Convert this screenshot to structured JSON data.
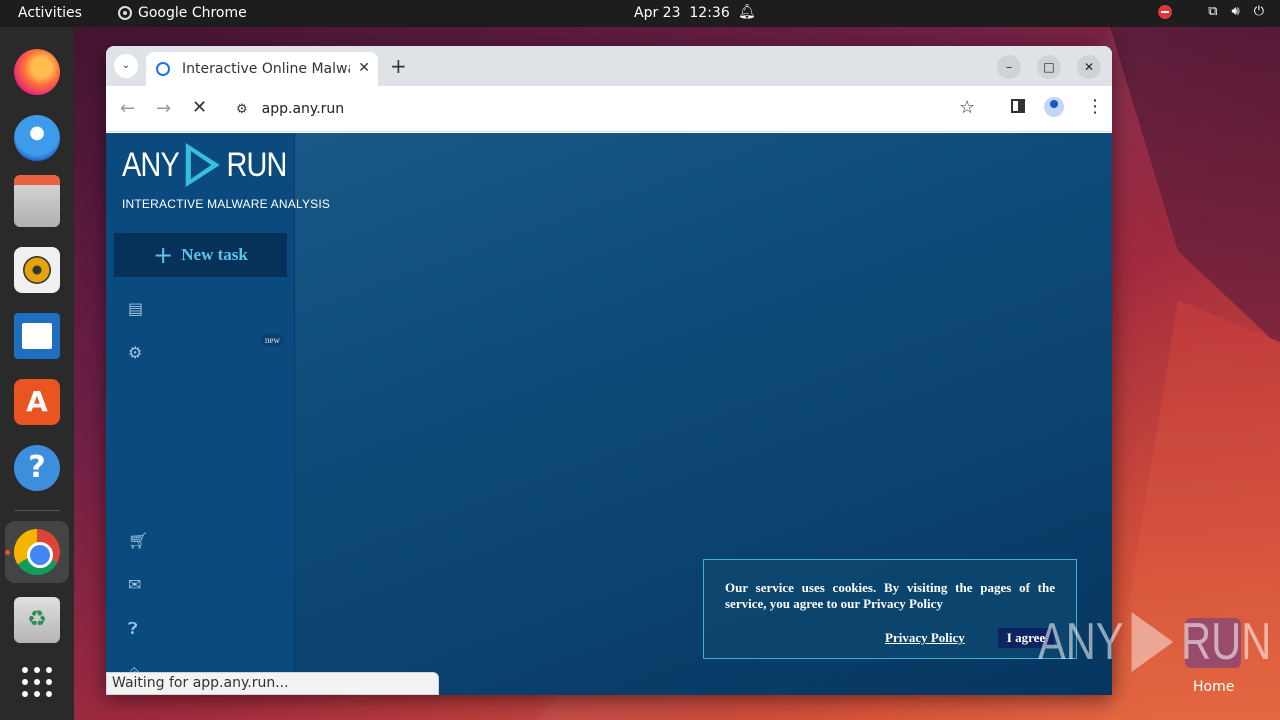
{
  "topbar": {
    "activities": "Activities",
    "app_name": "Google Chrome",
    "date": "Apr 23",
    "time": "12:36"
  },
  "dock": {
    "apps": [
      "firefox",
      "thunderbird",
      "files",
      "rhythmbox",
      "libreoffice-writer",
      "app-center",
      "help",
      "google-chrome",
      "trash",
      "show-apps"
    ]
  },
  "desktop": {
    "home_label": "Home"
  },
  "browser": {
    "tab_title": "Interactive Online Malware",
    "url": "app.any.run",
    "status": "Waiting for app.any.run..."
  },
  "page": {
    "logo_left": "ANY",
    "logo_right": "RUN",
    "logo_tagline": "INTERACTIVE MALWARE ANALYSIS",
    "new_task_label": "New task",
    "new_badge": "new",
    "cookie_message": "Our service uses cookies. By visiting the pages of the service, you agree to our Privacy Policy",
    "privacy_link": "Privacy Policy",
    "agree_button": "I agree"
  },
  "watermark": {
    "left": "ANY",
    "right": "RUN"
  },
  "colors": {
    "accent": "#35c0e0",
    "page_bg": "#0f4c7a",
    "sidebar_bg": "#0a4a7e",
    "ubuntu_orange": "#e95420"
  }
}
